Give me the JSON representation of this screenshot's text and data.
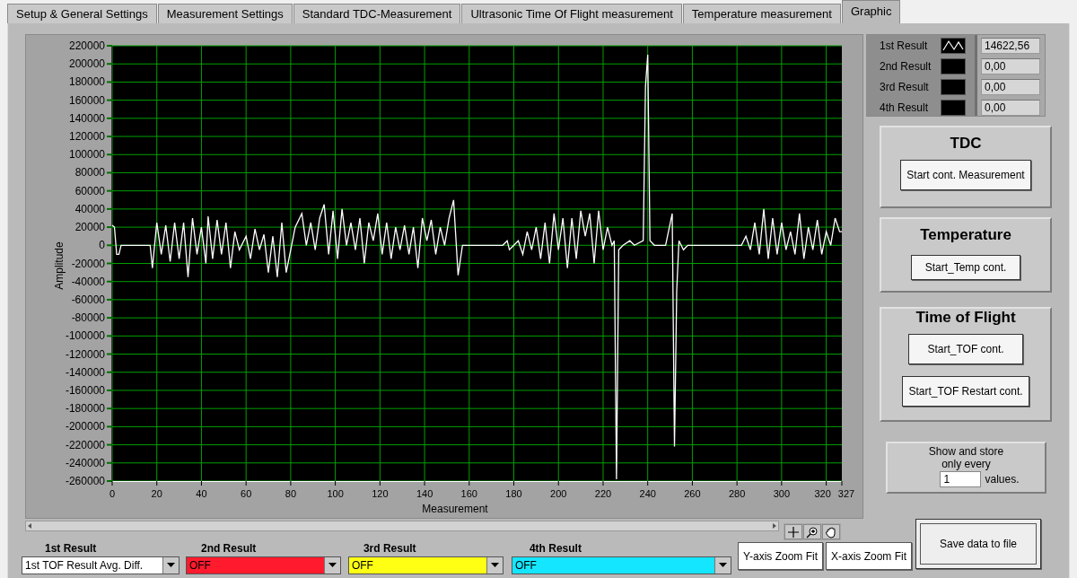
{
  "tabs": [
    {
      "label": "Setup & General Settings",
      "selected": false
    },
    {
      "label": "Measurement Settings",
      "selected": false
    },
    {
      "label": "Standard TDC-Measurement",
      "selected": false
    },
    {
      "label": "Ultrasonic Time Of Flight measurement",
      "selected": false
    },
    {
      "label": "Temperature measurement",
      "selected": false
    },
    {
      "label": "Graphic",
      "selected": true
    }
  ],
  "graph": {
    "chart_data": {
      "type": "line",
      "xlabel": "Measurement",
      "ylabel": "Amplitude",
      "xlim": [
        0,
        327
      ],
      "ylim": [
        -260000,
        220000
      ],
      "xticks": [
        0,
        20,
        40,
        60,
        80,
        100,
        120,
        140,
        160,
        180,
        200,
        220,
        240,
        260,
        280,
        300,
        320,
        327
      ],
      "yticks": [
        220000,
        200000,
        180000,
        160000,
        140000,
        120000,
        100000,
        80000,
        60000,
        40000,
        20000,
        0,
        -20000,
        -40000,
        -60000,
        -80000,
        -100000,
        -120000,
        -140000,
        -160000,
        -180000,
        -200000,
        -220000,
        -240000,
        -260000
      ],
      "x": [
        0,
        1,
        2,
        3,
        4,
        17,
        18,
        20,
        22,
        24,
        26,
        28,
        30,
        32,
        34,
        36,
        38,
        40,
        42,
        43,
        45,
        47,
        49,
        51,
        53,
        55,
        57,
        60,
        62,
        64,
        66,
        68,
        70,
        72,
        74,
        76,
        78,
        80,
        82,
        85,
        87,
        89,
        91,
        93,
        95,
        97,
        99,
        101,
        103,
        105,
        107,
        109,
        111,
        113,
        115,
        117,
        119,
        121,
        123,
        125,
        127,
        129,
        131,
        133,
        135,
        137,
        139,
        141,
        143,
        145,
        147,
        149,
        151,
        153,
        155,
        157,
        175,
        177,
        178,
        180,
        182,
        184,
        186,
        188,
        190,
        192,
        194,
        196,
        198,
        200,
        202,
        204,
        206,
        208,
        210,
        212,
        214,
        216,
        218,
        220,
        222,
        224,
        225,
        226,
        227,
        229,
        232,
        234,
        238,
        239,
        240,
        241,
        243,
        248,
        251,
        252,
        253,
        254,
        256,
        258,
        282,
        284,
        286,
        288,
        290,
        292,
        294,
        296,
        298,
        300,
        302,
        304,
        306,
        308,
        310,
        312,
        314,
        316,
        318,
        320,
        322,
        324,
        326,
        327
      ],
      "grid": true,
      "series": [
        {
          "color": "#ffffff",
          "values": [
            22000,
            20000,
            -10000,
            -10000,
            0,
            0,
            -25000,
            25000,
            -10000,
            22000,
            -18000,
            25000,
            -15000,
            25000,
            -35000,
            30000,
            -10000,
            20000,
            -20000,
            32000,
            -15000,
            28000,
            -10000,
            25000,
            -25000,
            15000,
            -5000,
            10000,
            -15000,
            18000,
            -5000,
            12000,
            -30000,
            10000,
            -35000,
            25000,
            -30000,
            -5000,
            20000,
            35000,
            0,
            25000,
            -5000,
            30000,
            45000,
            -10000,
            38000,
            -15000,
            40000,
            0,
            25000,
            -5000,
            30000,
            -20000,
            25000,
            5000,
            35000,
            -10000,
            25000,
            -15000,
            20000,
            -5000,
            22000,
            -10000,
            20000,
            -25000,
            30000,
            5000,
            28000,
            -10000,
            20000,
            0,
            30000,
            50000,
            -33000,
            0,
            0,
            5000,
            -5000,
            0,
            5000,
            -10000,
            15000,
            -5000,
            20000,
            -15000,
            25000,
            -20000,
            35000,
            -5000,
            30000,
            -25000,
            30000,
            -15000,
            38000,
            10000,
            35000,
            -20000,
            38000,
            -5000,
            20000,
            0,
            5000,
            -258000,
            -5000,
            0,
            5000,
            0,
            5000,
            175000,
            210000,
            5000,
            0,
            0,
            35000,
            -222000,
            -50000,
            5000,
            -5000,
            0,
            0,
            10000,
            -5000,
            25000,
            -10000,
            40000,
            -15000,
            30000,
            -10000,
            25000,
            -5000,
            15000,
            -10000,
            35000,
            -15000,
            20000,
            -5000,
            28000,
            -10000,
            15000,
            0,
            30000,
            15000,
            15000
          ]
        }
      ]
    }
  },
  "legend": [
    {
      "label": "1st Result",
      "line_shown": true,
      "value": "14622,56"
    },
    {
      "label": "2nd Result",
      "line_shown": false,
      "value": "0,00"
    },
    {
      "label": "3rd Result",
      "line_shown": false,
      "value": "0,00"
    },
    {
      "label": "4th Result",
      "line_shown": false,
      "value": "0,00"
    }
  ],
  "groups": [
    {
      "title": "TDC",
      "buttons": [
        "Start cont. Measurement"
      ]
    },
    {
      "title": "Temperature",
      "buttons": [
        "Start_Temp cont."
      ]
    },
    {
      "title": "Time of Flight",
      "buttons": [
        "Start_TOF cont.",
        "Start_TOF Restart cont."
      ]
    }
  ],
  "show_every": {
    "label": "Show and store only every",
    "value": "1",
    "unit": "values."
  },
  "save_button": "Save data to file",
  "selectors": [
    {
      "label": "1st Result",
      "value": "1st TOF Result Avg. Diff.",
      "color": "#ffffff"
    },
    {
      "label": "2nd Result",
      "value": "OFF",
      "color": "#ff1a2e"
    },
    {
      "label": "3rd Result",
      "value": "OFF",
      "color": "#ffff14"
    },
    {
      "label": "4th Result",
      "value": "OFF",
      "color": "#14e6ff"
    }
  ],
  "zoom_buttons": [
    "Y-axis Zoom Fit",
    "X-axis Zoom Fit"
  ]
}
